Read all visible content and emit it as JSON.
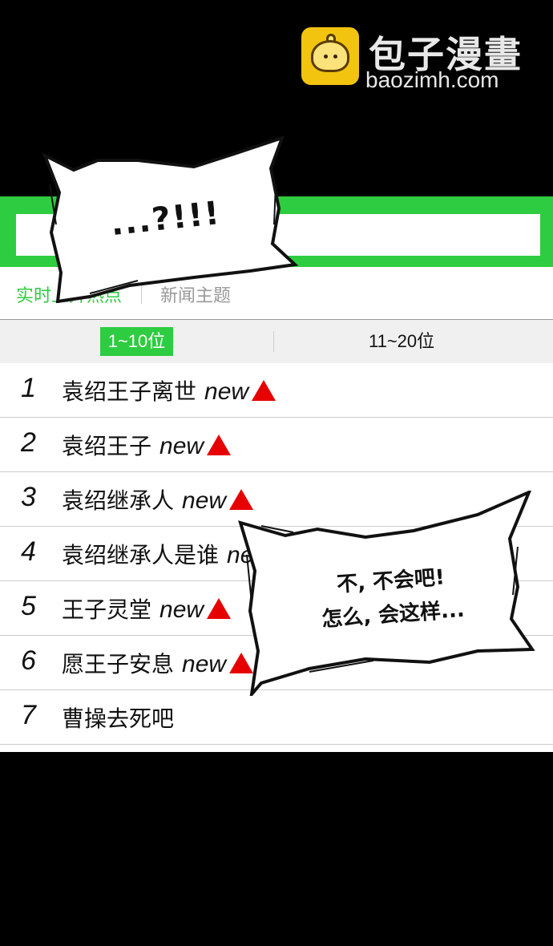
{
  "watermark": {
    "title": "包子漫畫",
    "url": "baozimh.com",
    "logo_icon": "baozi-bun-icon"
  },
  "search": {
    "value": "",
    "placeholder": ""
  },
  "tabs": {
    "hot_label": "实时上升热点",
    "news_label": "新闻主题"
  },
  "ranges": {
    "first": "1~10位",
    "second": "11~20位"
  },
  "list": [
    {
      "rank": "1",
      "term": "袁绍王子离世",
      "tag": "new",
      "trend": "up"
    },
    {
      "rank": "2",
      "term": "袁绍王子",
      "tag": "new",
      "trend": "up"
    },
    {
      "rank": "3",
      "term": "袁绍继承人",
      "tag": "new",
      "trend": "up"
    },
    {
      "rank": "4",
      "term": "袁绍继承人是谁",
      "tag": "new",
      "trend": "up"
    },
    {
      "rank": "5",
      "term": "王子灵堂",
      "tag": "new",
      "trend": "up"
    },
    {
      "rank": "6",
      "term": "愿王子安息",
      "tag": "new",
      "trend": "up"
    },
    {
      "rank": "7",
      "term": "曹操去死吧",
      "tag": "",
      "trend": ""
    }
  ],
  "bubbles": {
    "first": "...?!!!",
    "second_line1": "不, 不会吧!",
    "second_line2": "怎么, 会这样..."
  },
  "colors": {
    "accent": "#2ecc40",
    "trend_up": "#e60000",
    "background": "#000000"
  }
}
